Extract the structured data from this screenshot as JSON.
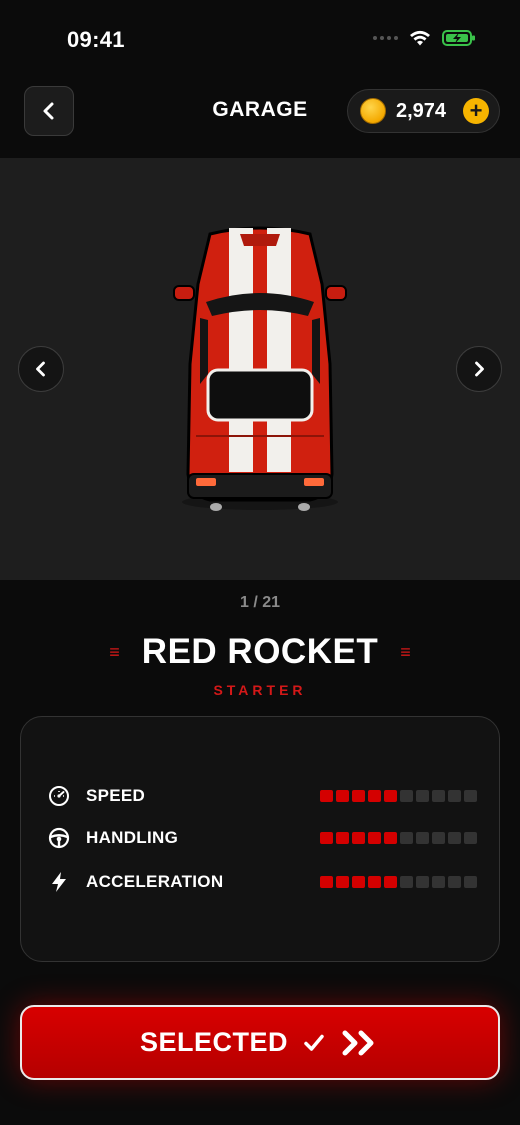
{
  "status_bar": {
    "time": "09:41"
  },
  "header": {
    "title": "GARAGE",
    "coins": "2,974"
  },
  "showcase": {
    "counter": "1 / 21"
  },
  "car": {
    "name": "RED ROCKET",
    "tier": "STARTER"
  },
  "stats": [
    {
      "label": "SPEED",
      "icon": "speedometer-icon",
      "level": 5,
      "max": 10
    },
    {
      "label": "HANDLING",
      "icon": "steering-wheel-icon",
      "level": 5,
      "max": 10
    },
    {
      "label": "ACCELERATION",
      "icon": "lightning-icon",
      "level": 5,
      "max": 10
    }
  ],
  "action": {
    "label": "SELECTED"
  },
  "colors": {
    "accent": "#d40000",
    "coin": "#f6b400",
    "background": "#0b0b0b"
  }
}
